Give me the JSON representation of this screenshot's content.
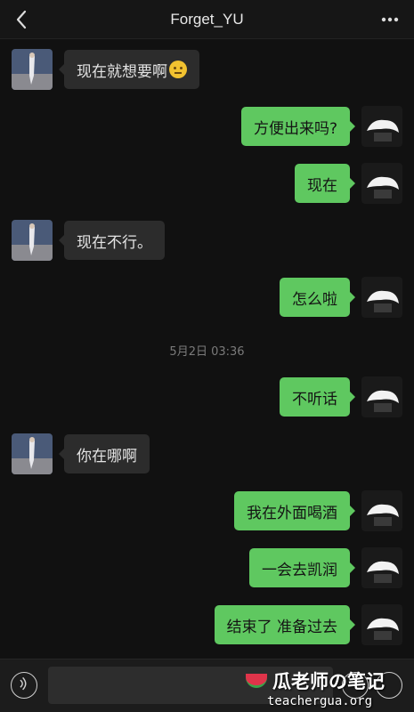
{
  "header": {
    "title": "Forget_YU",
    "back_icon": "chevron-left-icon",
    "more_icon": "more-dots-icon"
  },
  "messages": [
    {
      "side": "in",
      "text": "现在就想要啊",
      "emoji": "thinking-face-emoji"
    },
    {
      "side": "out",
      "text": "方便出来吗?"
    },
    {
      "side": "out",
      "text": "现在"
    },
    {
      "side": "in",
      "text": "现在不行。"
    },
    {
      "side": "out",
      "text": "怎么啦"
    },
    {
      "side": "out",
      "text": "不听话"
    },
    {
      "side": "in",
      "text": "你在哪啊"
    },
    {
      "side": "out",
      "text": "我在外面喝酒"
    },
    {
      "side": "out",
      "text": "一会去凯润"
    },
    {
      "side": "out",
      "text": "结束了 准备过去"
    }
  ],
  "timestamp": "5月2日 03:36",
  "input": {
    "placeholder": "",
    "voice_icon": "voice-icon",
    "emoji_icon": "emoji-icon",
    "plus_icon": "plus-icon"
  },
  "watermark": {
    "title": "瓜老师の笔记",
    "url": "teachergua.org"
  },
  "colors": {
    "outgoing_bubble": "#5fc860",
    "incoming_bubble": "#2c2c2c",
    "background": "#111111"
  }
}
